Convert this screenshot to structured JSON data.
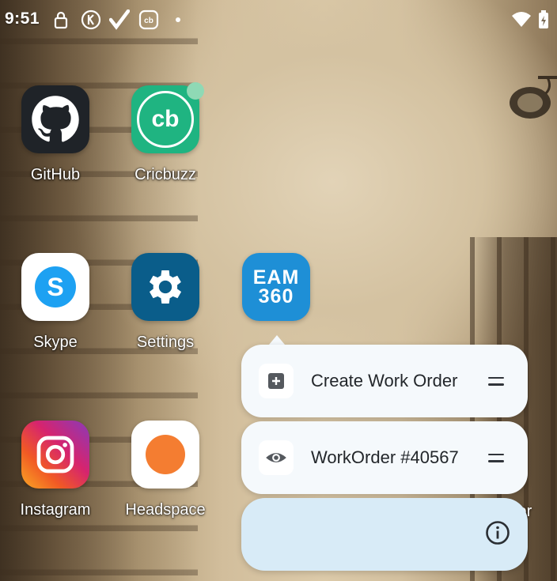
{
  "status_bar": {
    "time": "9:51",
    "icons": [
      "privacy-icon",
      "k-icon",
      "check-icon",
      "cricbuzz-notification-icon",
      "dot-icon",
      "wifi-icon",
      "battery-icon"
    ]
  },
  "apps": [
    {
      "label": "GitHub",
      "icon": "github-icon",
      "bg": "#1f2328"
    },
    {
      "label": "Cricbuzz",
      "icon": "cricbuzz-icon",
      "bg": "#1fb481",
      "glyph": "cb"
    },
    {
      "label": "Skype",
      "icon": "skype-icon",
      "bg": "#ffffff",
      "glyph": "S"
    },
    {
      "label": "Settings",
      "icon": "gear-icon",
      "bg": "#0a5d8a"
    },
    {
      "label": "EAM 360",
      "icon": "eam360-icon",
      "bg": "#1e8fd6",
      "line1": "EAM",
      "line2": "360"
    },
    {
      "label": "Instagram",
      "icon": "instagram-icon"
    },
    {
      "label": "Headspace",
      "icon": "headspace-icon",
      "bg": "#ffffff"
    }
  ],
  "shortcuts": [
    {
      "label": "Create Work Order",
      "icon": "plus-box-icon"
    },
    {
      "label": "WorkOrder #40567",
      "icon": "eye-icon"
    }
  ],
  "info_icon": "info-icon",
  "partial_label": "wer",
  "colors": {
    "popup_bg": "#f5f9fc",
    "info_bar_bg": "#d8ebf7",
    "cricbuzz_badge": "#8fd9b5"
  }
}
